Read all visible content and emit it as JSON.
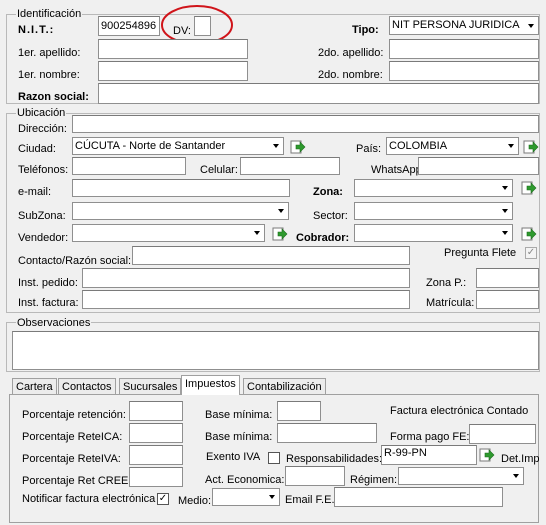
{
  "identificacion": {
    "title": "Identificación",
    "nit_label": "N.I.T.:",
    "nit_value": "900254896",
    "dv_label": "DV:",
    "dv_value": "",
    "tipo_label": "Tipo:",
    "tipo_value": "NIT PERSONA JURIDICA",
    "apellido1_label": "1er. apellido:",
    "apellido2_label": "2do. apellido:",
    "nombre1_label": "1er. nombre:",
    "nombre2_label": "2do. nombre:",
    "razon_label": "Razon social:"
  },
  "ubicacion": {
    "title": "Ubicación",
    "direccion_label": "Dirección:",
    "ciudad_label": "Ciudad:",
    "ciudad_value": "CÚCUTA - Norte de Santander",
    "pais_label": "País:",
    "pais_value": "COLOMBIA",
    "telefonos_label": "Teléfonos:",
    "celular_label": "Celular:",
    "whatsapp_label": "WhatsApp",
    "email_label": "e-mail:",
    "zona_label": "Zona:",
    "subzona_label": "SubZona:",
    "sector_label": "Sector:",
    "vendedor_label": "Vendedor:",
    "cobrador_label": "Cobrador:",
    "contacto_label": "Contacto/Razón social:",
    "pregunta_flete_label": "Pregunta Flete",
    "inst_pedido_label": "Inst. pedido:",
    "zona_p_label": "Zona P.:",
    "inst_factura_label": "Inst. factura:",
    "matricula_label": "Matrícula:"
  },
  "observaciones": {
    "title": "Observaciones"
  },
  "tabs": [
    {
      "label": "Cartera"
    },
    {
      "label": "Contactos"
    },
    {
      "label": "Sucursales"
    },
    {
      "label": "Impuestos"
    },
    {
      "label": "Contabilización"
    }
  ],
  "impuestos": {
    "retencion_label": "Porcentaje retención:",
    "reteica_label": "Porcentaje ReteICA:",
    "reteiva_label": "Porcentaje ReteIVA:",
    "retcree_label": "Porcentaje Ret CREE:",
    "notificar_label": "Notificar factura electrónica",
    "notificar_checked": "✓",
    "base_minima_label": "Base mínima:",
    "base_minima2_label": "Base mínima:",
    "exento_iva_label": "Exento IVA",
    "act_economica_label": "Act. Economica:",
    "medio_label": "Medio:",
    "factura_contado_label": "Factura electrónica Contado",
    "forma_pago_label": "Forma pago FE:",
    "responsabilidades_label": "Responsabilidades:",
    "responsabilidades_value": "R-99-PN",
    "regimen_label": "Régimen:",
    "det_imp_label": "Det.Imp",
    "email_fe_label": "Email F.E."
  },
  "colors": {
    "annotation": "#d0141a",
    "ok_green": "#2e9a2e"
  }
}
